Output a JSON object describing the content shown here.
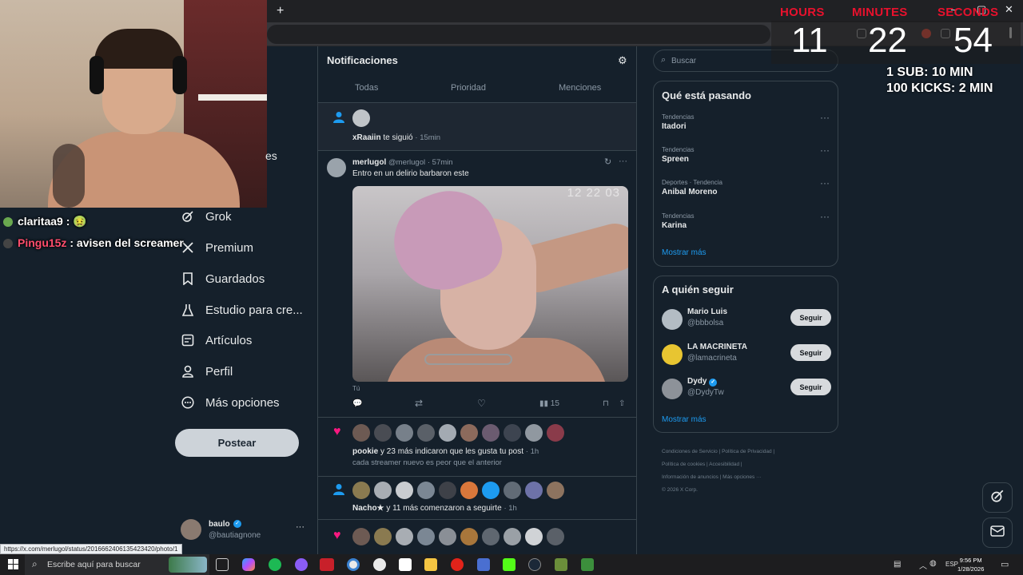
{
  "browser": {
    "new_tab": "+",
    "win_controls": [
      "–",
      "▢",
      "✕"
    ]
  },
  "overlay": {
    "labels": [
      "HOURS",
      "MINUTES",
      "SECONDS"
    ],
    "values": [
      "11",
      "22",
      "54"
    ],
    "info1": "1 SUB: 10 MIN",
    "info2": "100 KICKS: 2 MIN"
  },
  "chat": [
    {
      "user": "claritaa9",
      "msg": "🤢",
      "color": "#ffffff"
    },
    {
      "user": "Pingu15z",
      "msg": "avisen del screamer",
      "color": "#ff4d6d"
    }
  ],
  "nav": {
    "cut_label": "es",
    "items": [
      "Grok",
      "Premium",
      "Guardados",
      "Estudio para cre...",
      "Artículos",
      "Perfil",
      "Más opciones"
    ],
    "post_button": "Postear",
    "profile_name": "baulo",
    "profile_handle": "@bautiagnone"
  },
  "status_url": "https://x.com/merlugol/status/2016662406135423420/photo/1",
  "notifications": {
    "title": "Notificaciones",
    "tabs": [
      "Todas",
      "Prioridad",
      "Menciones"
    ],
    "follow1": {
      "user": "xRaaiin",
      "text": "te siguió",
      "time": "· 15min"
    },
    "post": {
      "name": "merlugol",
      "handle": "@merlugol",
      "time": "· 57min",
      "text": "Entro en un  delirio barbaron este",
      "media_timer": "12   22   03",
      "media_caption": "Tú",
      "views": "15"
    },
    "likes": {
      "user": "pookie",
      "text": "y 23 más indicaron que les gusta tu post",
      "time": "· 1h",
      "quote": "cada streamer nuevo es peor que el anterior"
    },
    "follows": {
      "user": "Nacho★",
      "text": "y 11 más comenzaron a seguirte",
      "time": "· 1h"
    }
  },
  "search": {
    "placeholder": "Buscar"
  },
  "trending": {
    "title": "Qué está pasando",
    "items": [
      {
        "category": "Tendencias",
        "name": "Itadori"
      },
      {
        "category": "Tendencias",
        "name": "Spreen"
      },
      {
        "category": "Deportes · Tendencia",
        "name": "Anibal Moreno"
      },
      {
        "category": "Tendencias",
        "name": "Karina"
      }
    ],
    "more": "Mostrar más"
  },
  "who_to_follow": {
    "title": "A quién seguir",
    "items": [
      {
        "name": "Mario Luis",
        "handle": "@bbbolsa",
        "button": "Seguir",
        "verified": false
      },
      {
        "name": "LA MACRINETA",
        "handle": "@lamacrineta",
        "button": "Seguir",
        "verified": false
      },
      {
        "name": "Dydy",
        "handle": "@DydyTw",
        "button": "Seguir",
        "verified": true
      }
    ],
    "more": "Mostrar más"
  },
  "footer": {
    "line1": [
      "Condiciones de Servicio",
      "|",
      "Política de Privacidad",
      "|"
    ],
    "line2": [
      "Política de cookies",
      "|",
      "Accesibilidad",
      "|"
    ],
    "line3": [
      "Información de anuncios",
      "|",
      "Más opciones ···"
    ],
    "copyright": "© 2026 X Corp."
  },
  "taskbar": {
    "search_placeholder": "Escribe aquí para buscar",
    "lang": "ESP",
    "time": "9:56 PM",
    "date": "1/28/2026"
  },
  "colors": {
    "background": "#15202b",
    "accent": "#1d9bf0",
    "overlay_red": "#e8112d",
    "like": "#f91880"
  }
}
